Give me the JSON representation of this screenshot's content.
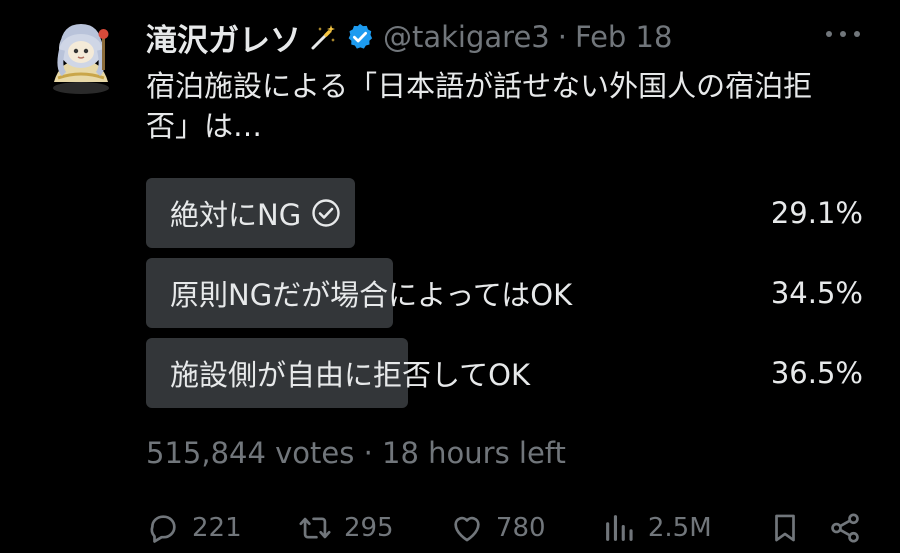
{
  "header": {
    "display_name": "滝沢ガレソ",
    "handle": "@takigare3",
    "separator": "·",
    "date": "Feb 18"
  },
  "tweet": {
    "text_line1": "宿泊施設による「日本語が話せない外国人の宿泊拒",
    "text_line2": "否」は…"
  },
  "poll": {
    "options": [
      {
        "label": "絶対にNG",
        "percent_label": "29.1%",
        "percent": 29.1,
        "selected": true
      },
      {
        "label": "原則NGだが場合によってはOK",
        "percent_label": "34.5%",
        "percent": 34.5,
        "selected": false
      },
      {
        "label": "施設側が自由に拒否してOK",
        "percent_label": "36.5%",
        "percent": 36.5,
        "selected": false
      }
    ],
    "meta": "515,844 votes · 18 hours left"
  },
  "actions": {
    "replies": "221",
    "reposts": "295",
    "likes": "780",
    "views": "2.5M"
  },
  "colors": {
    "background": "#000000",
    "text": "#e7e9ea",
    "muted": "#71767b",
    "poll_bar": "#333639",
    "verified": "#1d9bf0"
  },
  "icons": [
    "avatar",
    "magic-wand-icon",
    "verified-badge-icon",
    "more-icon",
    "check-circle-icon",
    "reply-icon",
    "repost-icon",
    "like-icon",
    "views-icon",
    "bookmark-icon",
    "share-icon"
  ]
}
